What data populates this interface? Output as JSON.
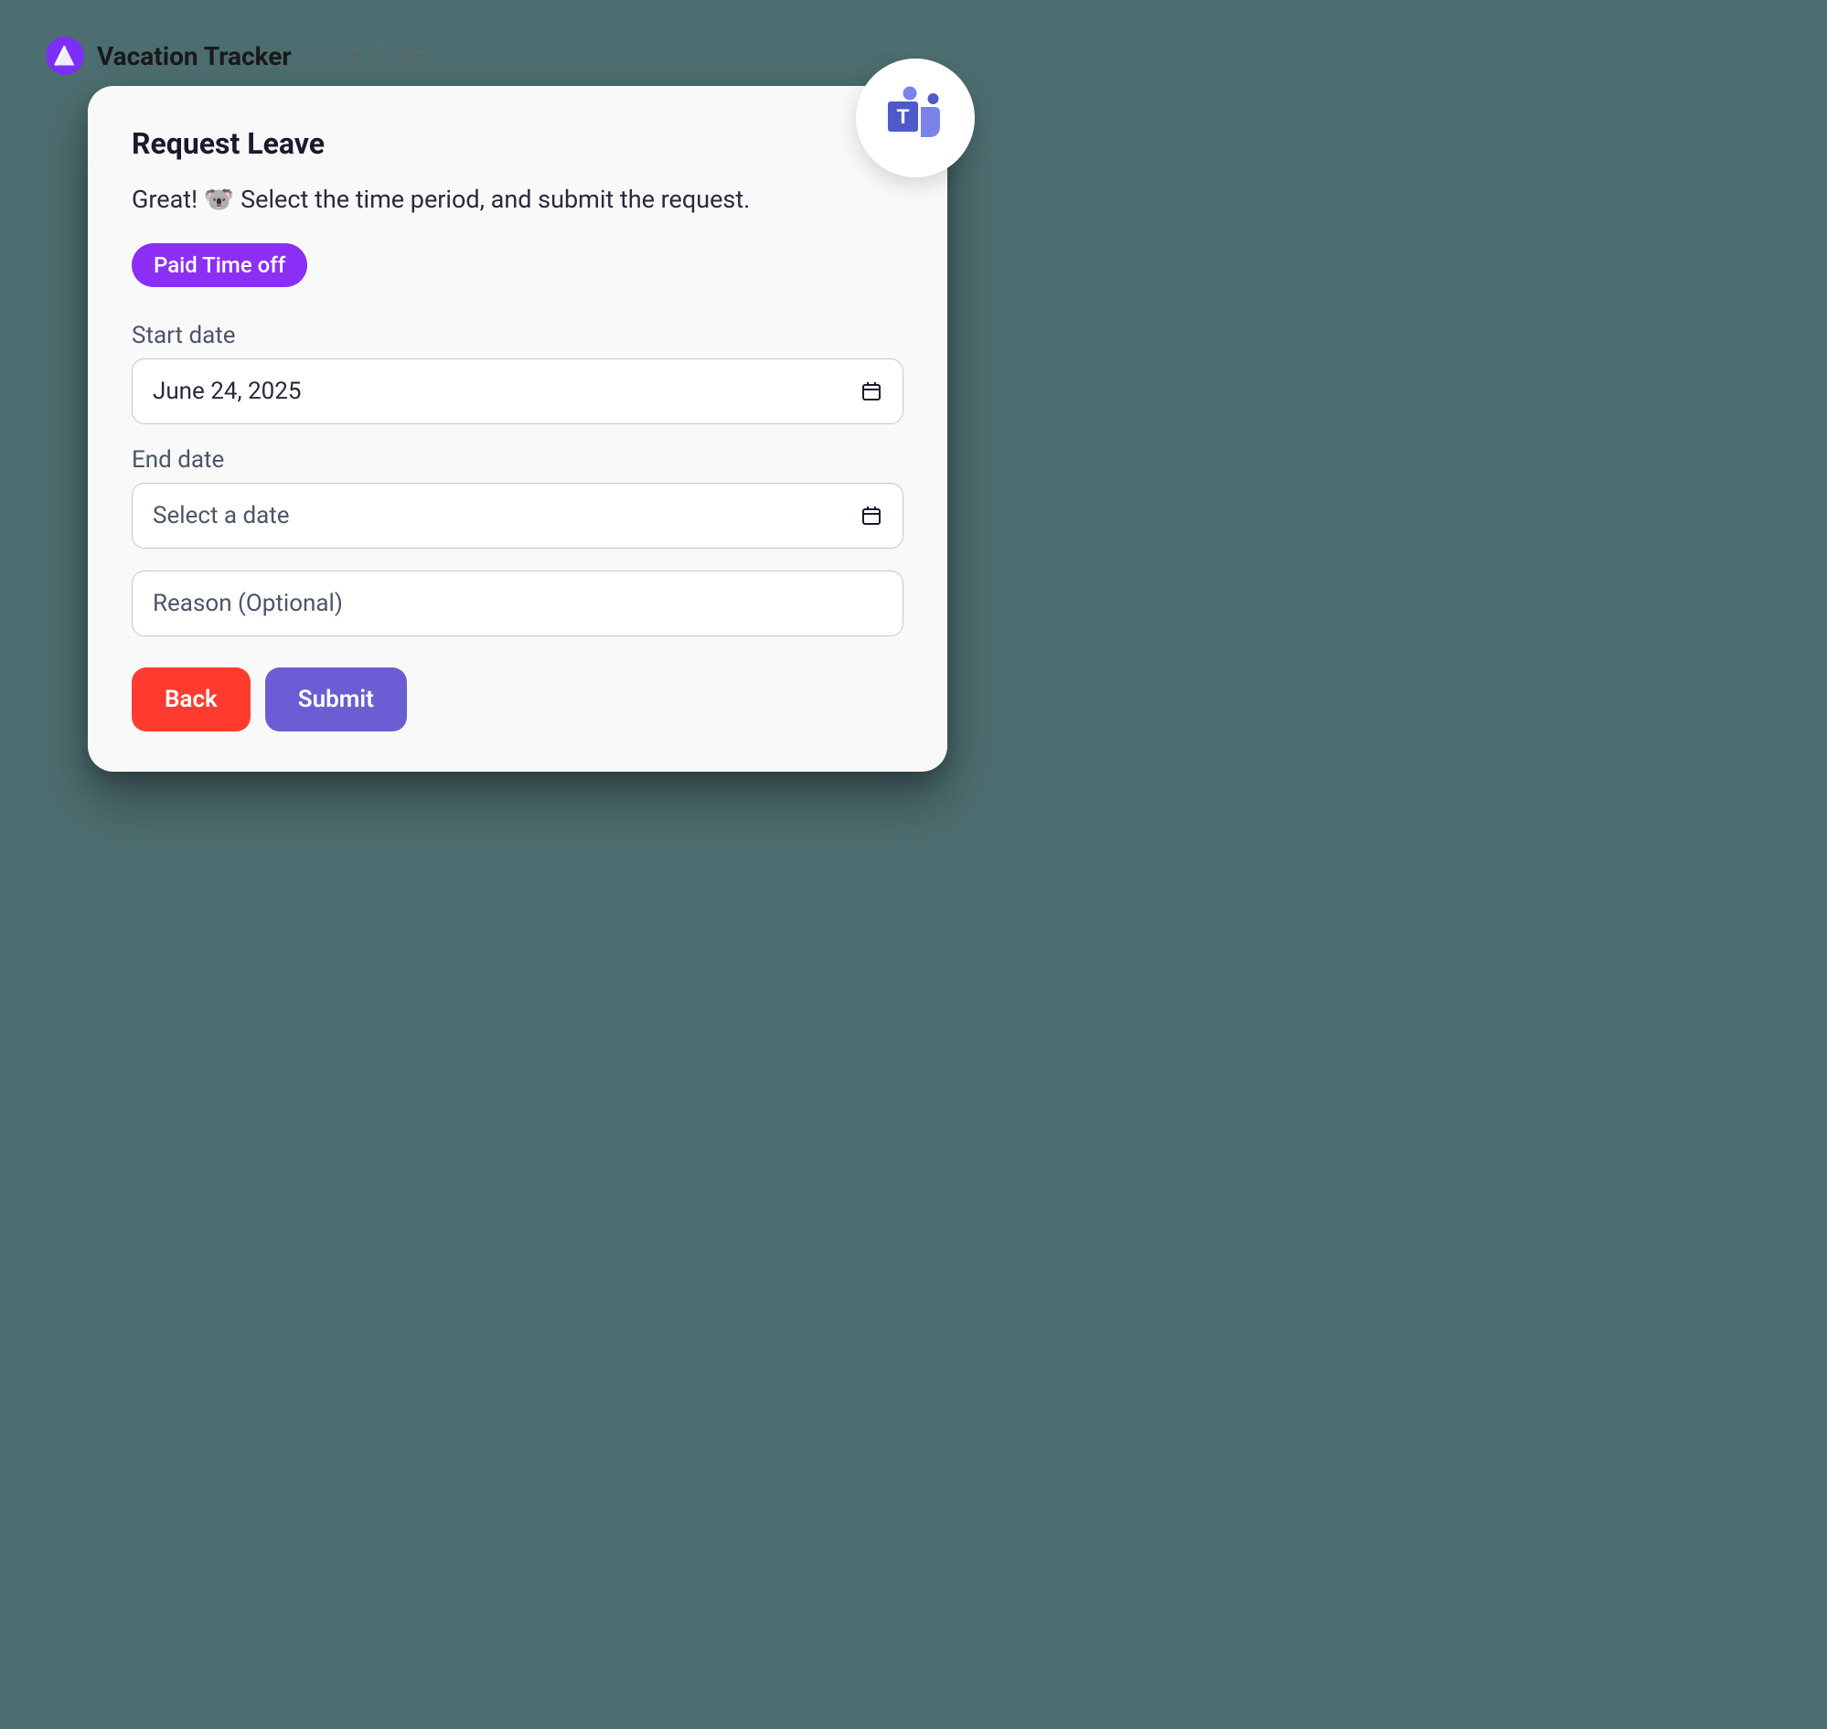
{
  "header": {
    "app_name": "Vacation Tracker",
    "timestamp": "3/9 4:02 pm"
  },
  "card": {
    "title": "Request Leave",
    "subtitle": "Great! 🐨 Select the time period, and submit the request.",
    "pill_label": "Paid Time off",
    "fields": {
      "start_date": {
        "label": "Start date",
        "value": "June 24, 2025"
      },
      "end_date": {
        "label": "End date",
        "placeholder": "Select a date"
      },
      "reason": {
        "placeholder": "Reason (Optional)"
      }
    },
    "buttons": {
      "back": "Back",
      "submit": "Submit"
    }
  }
}
